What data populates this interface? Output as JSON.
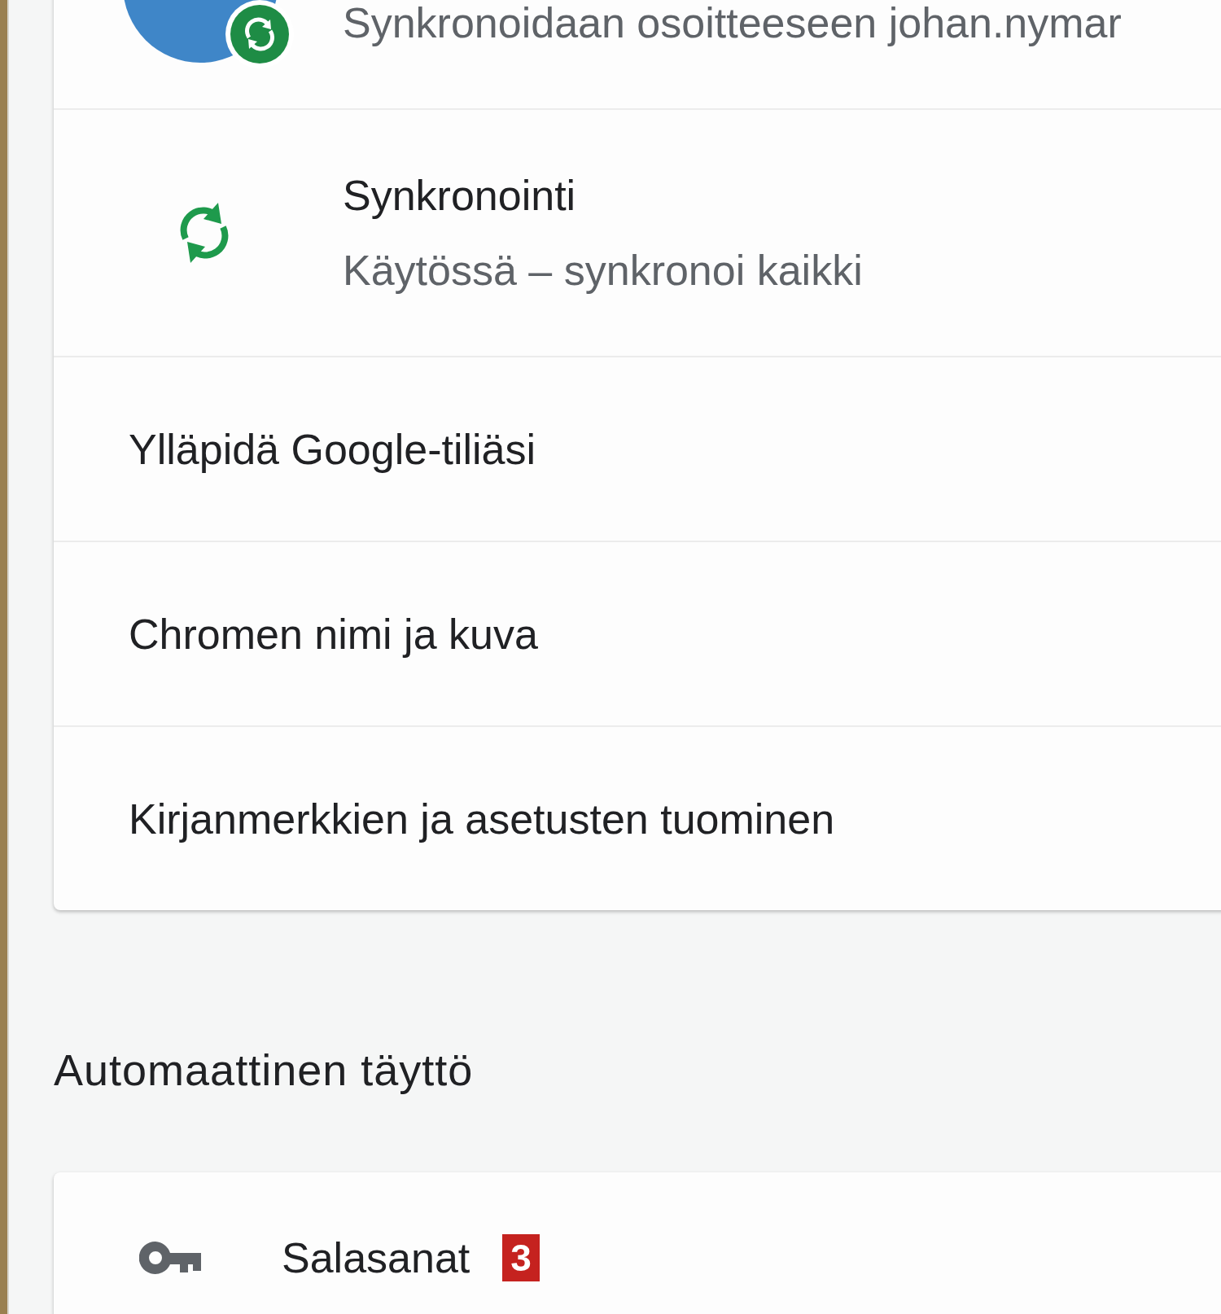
{
  "people_card": {
    "rows": [
      {
        "kind": "account",
        "subtitle": "Synkronoidaan osoitteeseen johan.nymar"
      },
      {
        "kind": "sync",
        "title": "Synkronointi",
        "subtitle": "Käytössä – synkronoi kaikki"
      },
      {
        "kind": "link",
        "title": "Ylläpidä Google-tiliäsi"
      },
      {
        "kind": "link",
        "title": "Chromen nimi ja kuva"
      },
      {
        "kind": "link",
        "title": "Kirjanmerkkien ja asetusten tuominen"
      }
    ]
  },
  "autofill": {
    "title": "Automaattinen täyttö",
    "rows": [
      {
        "kind": "passwords",
        "title": "Salasanat",
        "badge": "3"
      }
    ]
  }
}
